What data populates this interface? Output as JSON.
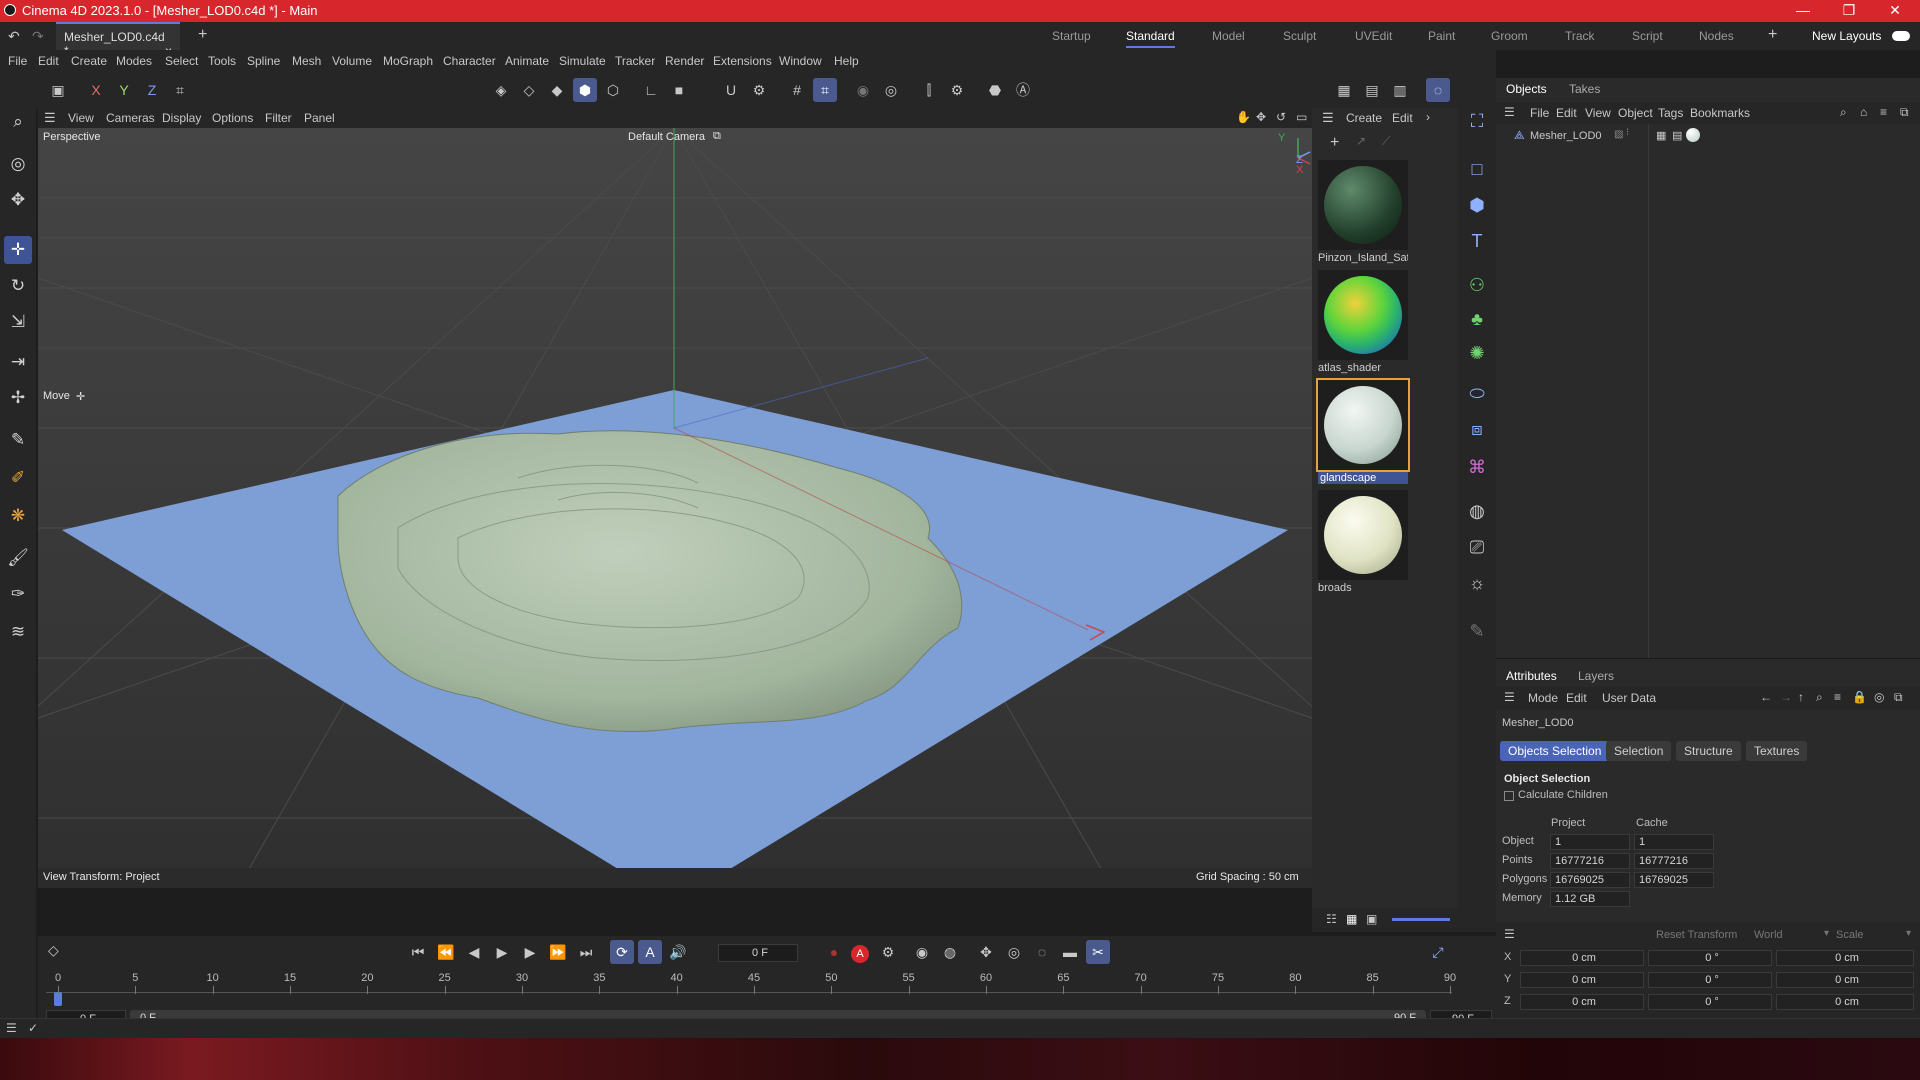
{
  "window": {
    "title": "Cinema 4D 2023.1.0 - [Mesher_LOD0.c4d *] - Main",
    "min": "—",
    "restore": "❐",
    "close": "✕"
  },
  "tabs": {
    "doc_tab": "Mesher_LOD0.c4d *",
    "add": "+",
    "layouts": [
      "Startup",
      "Standard",
      "Model",
      "Sculpt",
      "UVEdit",
      "Paint",
      "Groom",
      "Track",
      "Script",
      "Nodes"
    ],
    "active_layout": "Standard",
    "new_layouts": "New Layouts"
  },
  "menu": [
    "File",
    "Edit",
    "Create",
    "Modes",
    "Select",
    "Tools",
    "Spline",
    "Mesh",
    "Volume",
    "MoGraph",
    "Character",
    "Animate",
    "Simulate",
    "Tracker",
    "Render",
    "Extensions",
    "Window",
    "Help"
  ],
  "toolbar": {
    "x": "X",
    "y": "Y",
    "z": "Z"
  },
  "viewport": {
    "menu": [
      "View",
      "Cameras",
      "Display",
      "Options",
      "Filter",
      "Panel"
    ],
    "projection": "Perspective",
    "camera": "Default Camera",
    "tool": "Move",
    "view_transform": "View Transform: Project",
    "grid_spacing": "Grid Spacing : 50 cm",
    "axis_y": "Y",
    "axis_z": "Z",
    "axis_x": "X"
  },
  "material_panel": {
    "menu": [
      "Create",
      "Edit"
    ],
    "materials": [
      {
        "name": "Pinzon_Island_Sat",
        "color": "#2c5a38"
      },
      {
        "name": "atlas_shader",
        "color": "#3fd13a"
      },
      {
        "name": "glandscape",
        "color": "#d7e3dc",
        "selected": true
      },
      {
        "name": "broads",
        "color": "#e8ecd2"
      }
    ]
  },
  "objects_panel": {
    "tabs": [
      "Objects",
      "Takes"
    ],
    "active_tab": "Objects",
    "menu": [
      "File",
      "Edit",
      "View",
      "Object",
      "Tags",
      "Bookmarks"
    ],
    "items": [
      {
        "name": "Mesher_LOD0"
      }
    ]
  },
  "attributes": {
    "tabs": [
      "Attributes",
      "Layers"
    ],
    "active_tab": "Attributes",
    "menu": [
      "Mode",
      "Edit",
      "User Data"
    ],
    "object_name": "Mesher_LOD0",
    "subtabs": [
      "Objects Selection",
      "Selection",
      "Structure",
      "Textures"
    ],
    "active_subtab": "Objects Selection",
    "section_title": "Object Selection",
    "calculate_children": "Calculate Children",
    "col_project": "Project",
    "col_cache": "Cache",
    "rows": [
      {
        "label": "Object",
        "project": "1",
        "cache": "1"
      },
      {
        "label": "Points",
        "project": "16777216",
        "cache": "16777216"
      },
      {
        "label": "Polygons",
        "project": "16769025",
        "cache": "16769025"
      },
      {
        "label": "Memory",
        "project": "1.12 GB",
        "cache": ""
      }
    ],
    "transform": {
      "reset": "Reset Transform",
      "space": "World",
      "mode": "Scale",
      "rows": [
        {
          "axis": "X",
          "pos": "0 cm",
          "rot": "0 °",
          "scale": "0 cm"
        },
        {
          "axis": "Y",
          "pos": "0 cm",
          "rot": "0 °",
          "scale": "0 cm"
        },
        {
          "axis": "Z",
          "pos": "0 cm",
          "rot": "0 °",
          "scale": "0 cm"
        }
      ]
    }
  },
  "timeline": {
    "current_frame": "0 F",
    "start": "0 F",
    "start2": "0 F",
    "end": "90 F",
    "end2": "90 F",
    "ruler": [
      "0",
      "5",
      "10",
      "15",
      "20",
      "25",
      "30",
      "35",
      "40",
      "45",
      "50",
      "55",
      "60",
      "65",
      "70",
      "75",
      "80",
      "85",
      "90"
    ]
  },
  "colors": {
    "accent": "#4a64b8",
    "title_bar": "#d8262d",
    "water": "#7d9fd6",
    "terrain": "#a8bba3"
  }
}
